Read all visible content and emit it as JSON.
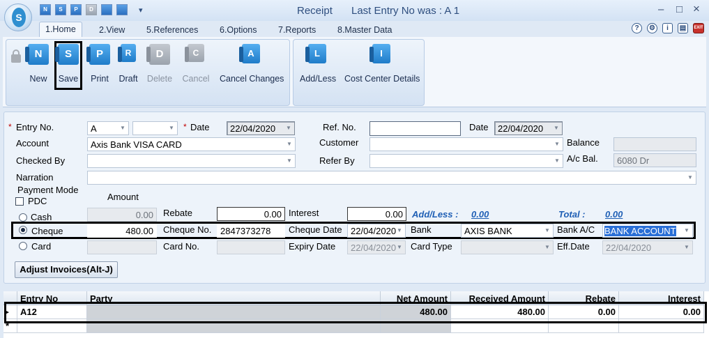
{
  "window": {
    "title": "Receipt",
    "subtitle": "Last Entry No was : A 1",
    "minimize": "–",
    "restore": "□",
    "close": "×",
    "logo_letter": "S"
  },
  "quick_access": [
    {
      "letter": "N",
      "icon": "new-icon"
    },
    {
      "letter": "S",
      "icon": "save-icon"
    },
    {
      "letter": "P",
      "icon": "print-icon"
    },
    {
      "letter": "D",
      "icon": "delete-icon"
    },
    {
      "letter": "",
      "icon": "exit-icon"
    },
    {
      "letter": "",
      "icon": "close-doc-icon"
    }
  ],
  "qa_dropdown": "▾",
  "tabs": [
    "1.Home",
    "2.View",
    "5.References",
    "6.Options",
    "7.Reports",
    "8.Master Data"
  ],
  "header_icons": [
    "help-icon",
    "settings-icon",
    "info-icon",
    "notes-icon",
    "exit-icon"
  ],
  "header_icon_glyphs": [
    "?",
    "⚙",
    "i",
    "▤",
    "EXIT"
  ],
  "ribbon": {
    "buttons": [
      {
        "label": "New",
        "letter": "N",
        "enabled": true
      },
      {
        "label": "Save",
        "letter": "S",
        "enabled": true
      },
      {
        "label": "Print",
        "letter": "P",
        "enabled": true
      },
      {
        "label": "Draft",
        "letter": "R",
        "enabled": true
      },
      {
        "label": "Delete",
        "letter": "D",
        "enabled": false
      },
      {
        "label": "Cancel",
        "letter": "C",
        "enabled": false
      },
      {
        "label": "Cancel Changes",
        "letter": "A",
        "enabled": true
      }
    ],
    "buttons2": [
      {
        "label": "Add/Less",
        "letter": "L"
      },
      {
        "label": "Cost Center Details",
        "letter": "I"
      }
    ]
  },
  "form": {
    "entry_no_label": "Entry No.",
    "entry_no_value": "A",
    "entry_no_suffix": "",
    "date_label": "Date",
    "date_value": "22/04/2020",
    "ref_no_label": "Ref. No.",
    "ref_no_value": "",
    "ref_date_label": "Date",
    "ref_date_value": "22/04/2020",
    "account_label": "Account",
    "account_value": "Axis Bank VISA CARD",
    "customer_label": "Customer",
    "customer_value": "",
    "balance_label": "Balance",
    "balance_value": "",
    "checked_by_label": "Checked By",
    "checked_by_value": "",
    "refer_by_label": "Refer By",
    "refer_by_value": "",
    "ac_bal_label": "A/c Bal.",
    "ac_bal_value": "6080 Dr",
    "narration_label": "Narration",
    "narration_value": "",
    "payment_mode_label": "Payment Mode",
    "pdc_label": "PDC",
    "amount_label": "Amount",
    "cash_label": "Cash",
    "cash_amount": "0.00",
    "rebate_label": "Rebate",
    "rebate_value": "0.00",
    "interest_label": "Interest",
    "interest_value": "0.00",
    "addless_label": "Add/Less :",
    "addless_value": "0.00",
    "total_label": "Total :",
    "total_value": "0.00",
    "cheque_label": "Cheque",
    "cheque_amount": "480.00",
    "cheque_no_label": "Cheque No.",
    "cheque_no_value": "2847373278",
    "cheque_date_label": "Cheque Date",
    "cheque_date_value": "22/04/2020",
    "bank_label": "Bank",
    "bank_value": "AXIS BANK",
    "bank_ac_label": "Bank A/C",
    "bank_ac_value": "BANK ACCOUNT",
    "card_label": "Card",
    "card_amount": "",
    "card_no_label": "Card No.",
    "card_no_value": "",
    "expiry_label": "Expiry Date",
    "expiry_value": "22/04/2020",
    "card_type_label": "Card Type",
    "card_type_value": "",
    "eff_date_label": "Eff.Date",
    "eff_date_value": "22/04/2020",
    "adjust_button": "Adjust Invoices(Alt-J)",
    "payment_mode_selected": "Cheque"
  },
  "grid": {
    "columns": [
      "Entry No",
      "Party",
      "Net Amount",
      "Received Amount",
      "Rebate",
      "Interest"
    ],
    "rows": [
      {
        "entry_no": "A12",
        "party": "",
        "net_amount": "480.00",
        "received_amount": "480.00",
        "rebate": "0.00",
        "interest": "0.00"
      }
    ],
    "current_row_marker": "▸",
    "new_row_marker": "*"
  },
  "colors": {
    "accent": "#2a6fd6",
    "link_blue": "#1f5fb5",
    "required": "#c00000"
  }
}
